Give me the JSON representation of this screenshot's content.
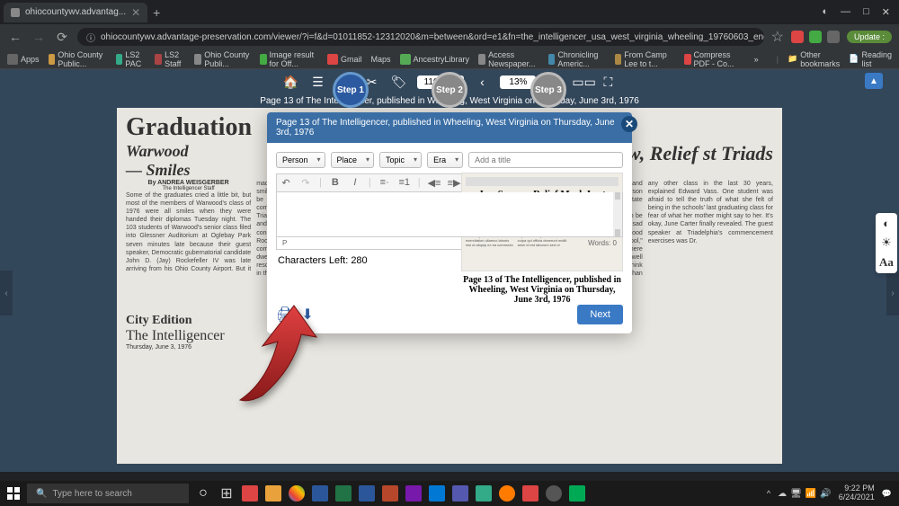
{
  "browser": {
    "tab_title": "ohiocountywv.advantag...",
    "url": "ohiocountywv.advantage-preservation.com/viewer/?i=f&d=01011852-12312020&m=between&ord=e1&fn=the_intelligencer_usa_west_virginia_wheeling_19760603_english_13&df=1&dt=2",
    "update_label": "Update :",
    "window_controls": {
      "min": "—",
      "max": "□",
      "close": "✕"
    }
  },
  "bookmarks": {
    "apps": "Apps",
    "items": [
      "Ohio County Public...",
      "LS2 PAC",
      "LS2 Staff",
      "Ohio County Publi...",
      "Image result for Off...",
      "Gmail",
      "Maps",
      "AncestryLibrary",
      "Access Newspaper...",
      "Chronicling Americ...",
      "From Camp Lee to t...",
      "Compress PDF - Co..."
    ],
    "more": "»",
    "other": "Other bookmarks",
    "reading": "Reading list"
  },
  "viewer": {
    "zoom": "110%",
    "page_input": "13%",
    "subtitle": "Page 13 of The Intelligencer, published in Wheeling, West Virginia on Thursday, June 3rd, 1976",
    "steps": [
      "Step 1",
      "Step 2",
      "Step 3"
    ]
  },
  "newspaper": {
    "headline": "Graduation",
    "sub1": "Warwood",
    "sub2": "— Smiles",
    "byline": "By ANDREA WEISGERBER",
    "byline2": "The Intelligencer Staff",
    "sub3": "ow, Relief st Triads",
    "city_ed": "City Edition",
    "masthead": "The Intelligencer",
    "date": "Thursday, June 3, 1976"
  },
  "modal": {
    "title": "Page 13 of The Intelligencer, published in Wheeling, West Virginia on Thursday, June 3rd, 1976",
    "dropdowns": {
      "person": "Person",
      "place": "Place",
      "topic": "Topic",
      "era": "Era"
    },
    "title_placeholder": "Add a title",
    "editor_status_p": "P",
    "editor_status_words": "Words: 0",
    "chars_left": "Characters Left: 280",
    "clip_headline": "Joy, Sorrow, Relief Mark Last Triads",
    "clip_caption": "Page 13 of The Intelligencer, published in Wheeling, West Virginia on Thursday, June 3rd, 1976",
    "next": "Next"
  },
  "taskbar": {
    "search_placeholder": "Type here to search",
    "time": "9:22 PM",
    "date": "6/24/2021"
  }
}
